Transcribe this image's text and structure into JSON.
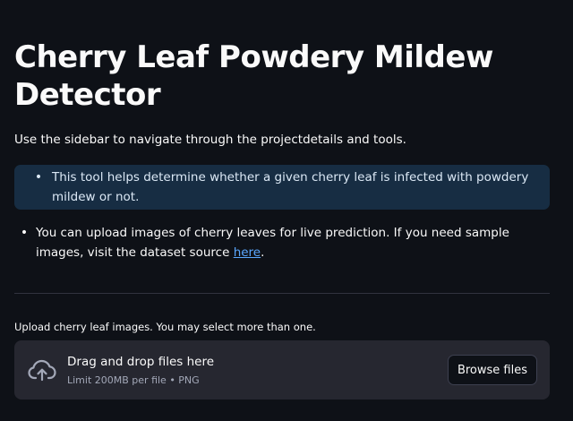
{
  "page": {
    "title": "Cherry Leaf Powdery Mildew Detector",
    "intro": "Use the sidebar to navigate through the projectdetails and tools."
  },
  "info_box": {
    "text": "This tool helps determine whether a given cherry leaf is infected with powdery mildew or not."
  },
  "list": {
    "text_before_link": "You can upload images of cherry leaves for live prediction. If you need sample images, visit the dataset source ",
    "link_text": "here",
    "text_after_link": "."
  },
  "uploader": {
    "label": "Upload cherry leaf images. You may select more than one.",
    "dropzone_title": "Drag and drop files here",
    "dropzone_subtitle": "Limit 200MB per file • PNG",
    "browse_label": "Browse files",
    "icon": "cloud-upload-icon"
  },
  "colors": {
    "background": "#0e1117",
    "info_bg": "#172d43",
    "dropzone_bg": "#262730",
    "link": "#5ba8ff"
  }
}
